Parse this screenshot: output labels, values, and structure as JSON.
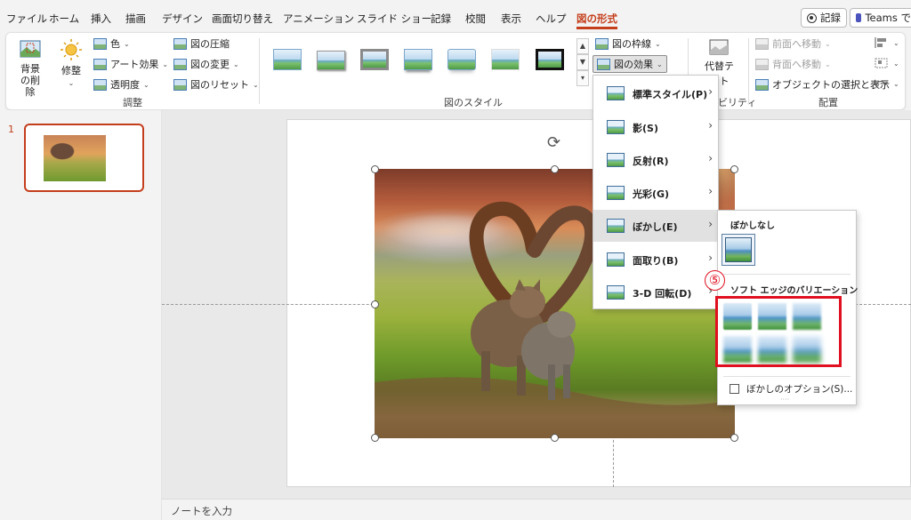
{
  "menubar": {
    "tabs": [
      "ファイル",
      "ホーム",
      "挿入",
      "描画",
      "デザイン",
      "画面切り替え",
      "アニメーション",
      "スライド ショー",
      "記録",
      "校閲",
      "表示",
      "ヘルプ",
      "図の形式"
    ],
    "record_button": "記録",
    "teams_button": "Teams で"
  },
  "ribbon": {
    "remove_bg": "背景の削除",
    "correct": "修整",
    "color": "色",
    "art_effects": "アート効果",
    "transparency": "透明度",
    "compress": "図の圧縮",
    "change_picture": "図の変更",
    "reset_picture": "図のリセット",
    "group_adjust": "調整",
    "group_styles": "図のスタイル",
    "border": "図の枠線",
    "effects": "図の効果",
    "alt_text_a": "代替テ",
    "alt_text_b": "スト",
    "accessibility_suffix": "ビリティ",
    "bring_forward": "前面へ移動",
    "send_backward": "背面へ移動",
    "selection_pane": "オブジェクトの選択と表示",
    "group_arrange": "配置"
  },
  "slides": {
    "number": "1"
  },
  "notes": {
    "placeholder": "ノートを入力"
  },
  "effects_menu": {
    "items": [
      "標準スタイル(P)",
      "影(S)",
      "反射(R)",
      "光彩(G)",
      "ぼかし(E)",
      "面取り(B)",
      "3-D 回転(D)"
    ],
    "highlighted": "ぼかし(E)"
  },
  "blur_submenu": {
    "none_heading": "ぼかしなし",
    "variations_heading": "ソフト エッジのバリエーション",
    "options_label": "ぼかしのオプション(S)...",
    "callout_number": "⑤"
  },
  "colors": {
    "accent": "#c43e1c",
    "highlight_box": "#e01020"
  }
}
